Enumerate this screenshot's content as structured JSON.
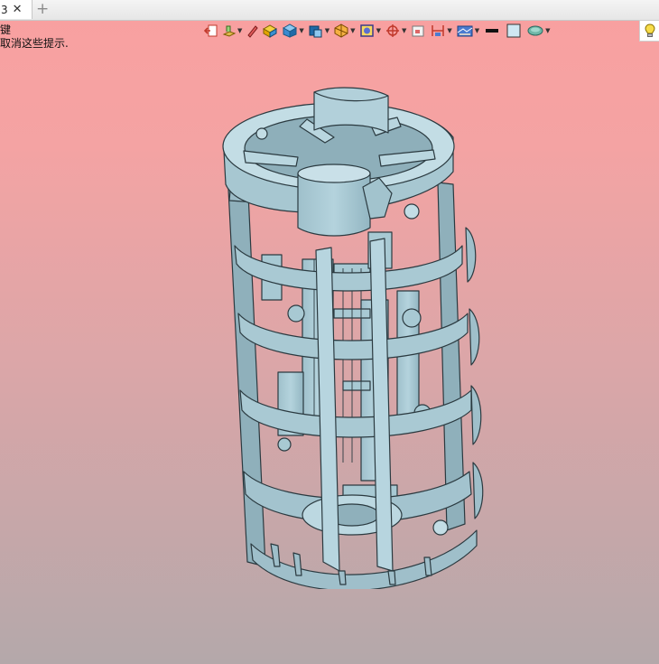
{
  "tab": {
    "title": "3",
    "close_glyph": "✕",
    "new_glyph": "+"
  },
  "hint": {
    "line1": "键",
    "line2": "取消这些提示."
  },
  "toolbar": {
    "icons": [
      "exit-view-icon",
      "render-style-icon",
      "pencil-icon",
      "display-mode-icon",
      "shaded-cube-icon",
      "view-orientation-icon",
      "section-view-icon",
      "appearance-icon",
      "target-icon",
      "hide-show-icon",
      "dimension-icon",
      "scene-icon",
      "line-color-icon",
      "background-color-icon",
      "material-icon",
      "light-bulb-icon"
    ]
  },
  "colors": {
    "bg_top": "#f9a0a0",
    "bg_bottom": "#b4a8aa",
    "model_fill": "#a9c8d2",
    "model_edge": "#2b3a40"
  }
}
